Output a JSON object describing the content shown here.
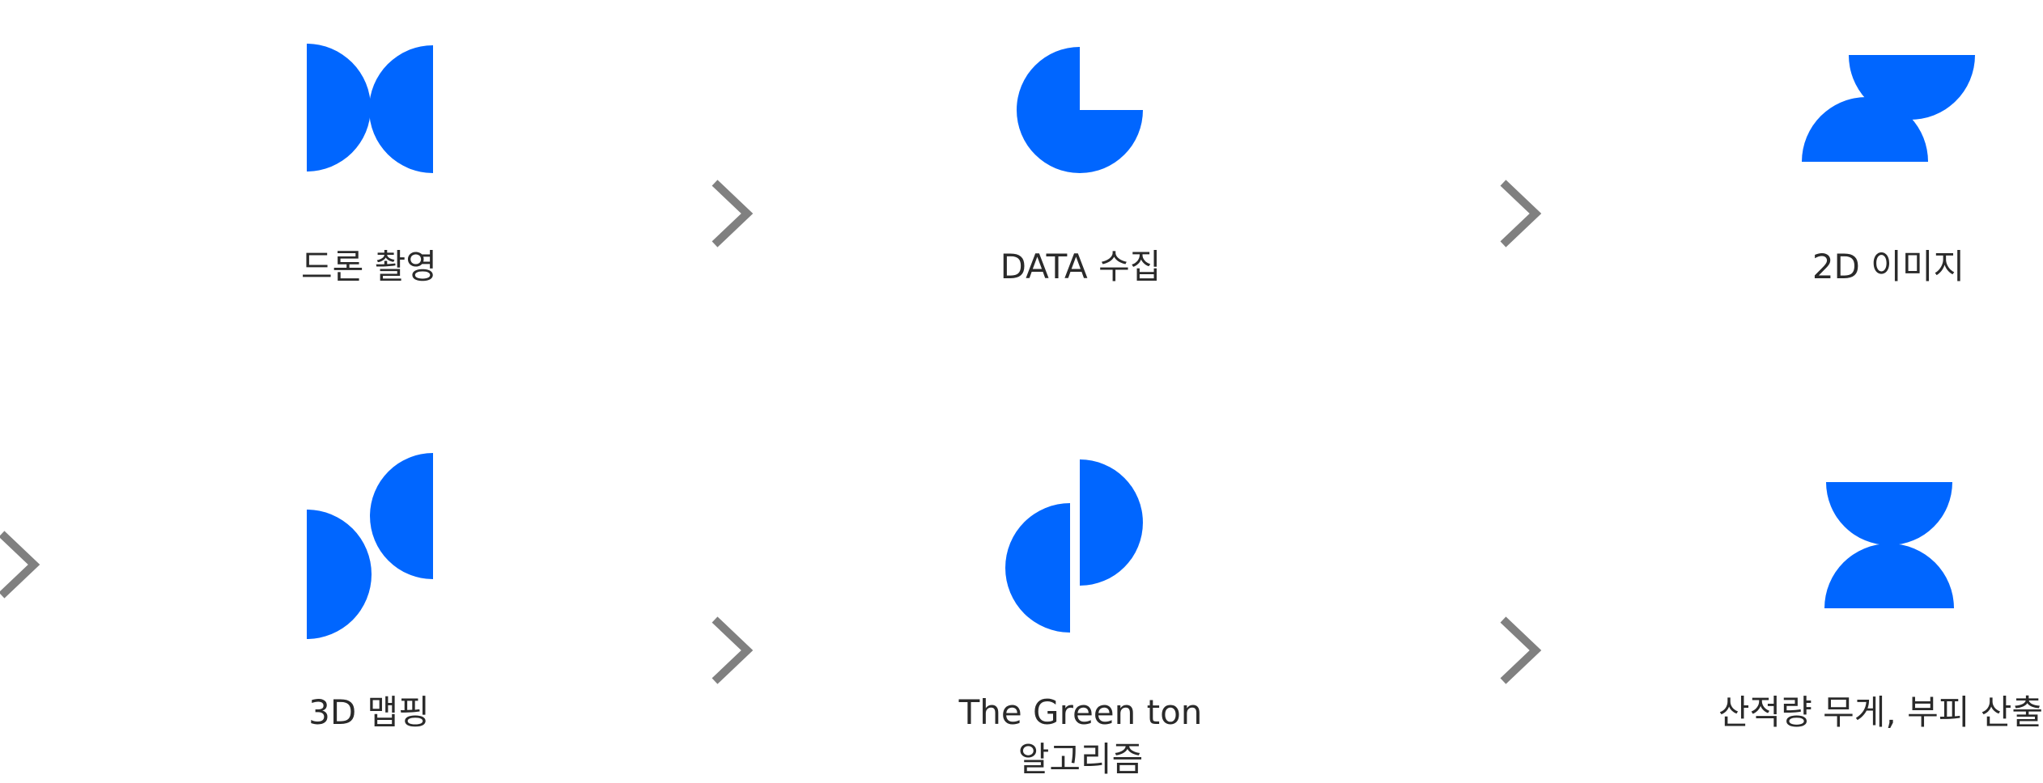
{
  "colors": {
    "accent": "#0066FF",
    "arrow": "#808080",
    "text": "#2a2a2a"
  },
  "steps": [
    {
      "label": "드론 촬영",
      "icon": "bowtie-halfcircles-icon"
    },
    {
      "label": "DATA 수집",
      "icon": "pie-three-quarter-icon"
    },
    {
      "label": "2D 이미지",
      "icon": "z-halfcircles-icon"
    },
    {
      "label": "3D 맵핑",
      "icon": "offset-halfcircles-icon"
    },
    {
      "label": "The Green ton",
      "label2": "알고리즘",
      "icon": "split-halfcircles-icon"
    },
    {
      "label": "산적량 무게, 부피 산출",
      "icon": "hourglass-halfcircles-icon"
    }
  ]
}
